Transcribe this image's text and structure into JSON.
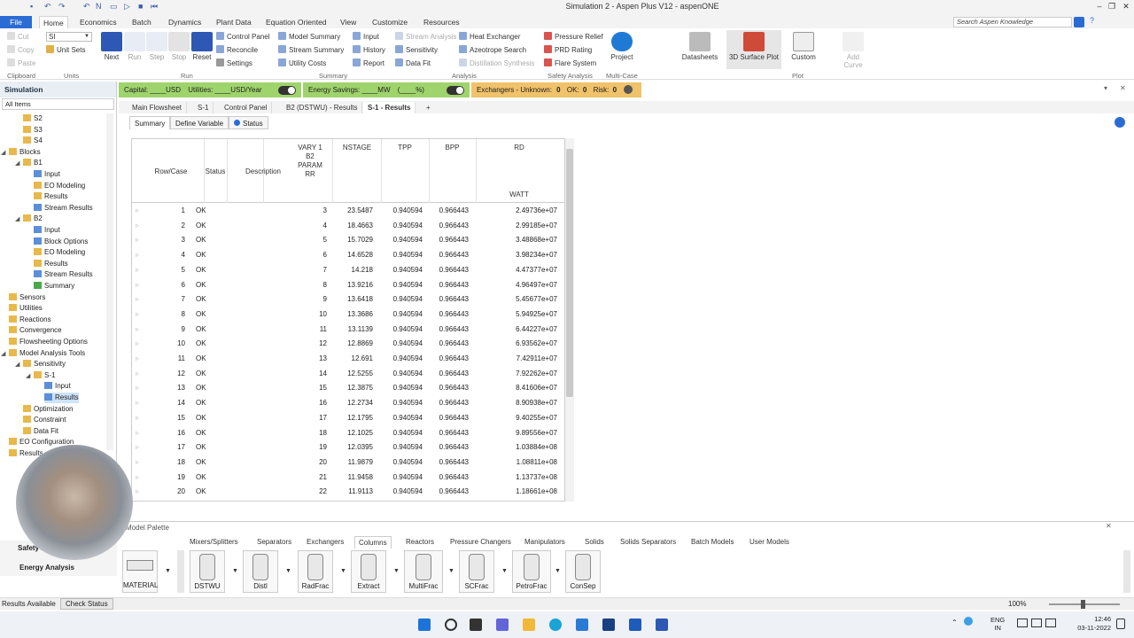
{
  "window": {
    "title": "Simulation 2 - Aspen Plus V12 - aspenONE"
  },
  "ribbon_tabs": [
    "File",
    "Home",
    "Economics",
    "Batch",
    "Dynamics",
    "Plant Data",
    "Equation Oriented",
    "View",
    "Customize",
    "Resources"
  ],
  "search": {
    "placeholder": "Search Aspen Knowledge"
  },
  "ribbon": {
    "clipboard": {
      "cut": "Cut",
      "copy": "Copy",
      "paste": "Paste",
      "group": "Clipboard"
    },
    "units": {
      "value": "SI",
      "unit_sets": "Unit Sets",
      "group": "Units"
    },
    "run": {
      "next": "Next",
      "run": "Run",
      "step": "Step",
      "stop": "Stop",
      "reset": "Reset",
      "control_panel": "Control Panel",
      "reconcile": "Reconcile",
      "settings": "Settings",
      "group": "Run"
    },
    "summary": {
      "model_summary": "Model Summary",
      "stream_summary": "Stream Summary",
      "utility_costs": "Utility Costs",
      "input": "Input",
      "history": "History",
      "report": "Report",
      "group": "Summary"
    },
    "analysis": {
      "stream_analysis": "Stream Analysis",
      "sensitivity": "Sensitivity",
      "data_fit": "Data Fit",
      "heat_exchanger": "Heat Exchanger",
      "azeotrope_search": "Azeotrope Search",
      "distillation_synthesis": "Distillation Synthesis",
      "group": "Analysis"
    },
    "safety": {
      "pressure_relief": "Pressure Relief",
      "prd_rating": "PRD Rating",
      "flare_system": "Flare System",
      "group": "Safety Analysis"
    },
    "multicase": {
      "project": "Project",
      "group": "Multi-Case"
    },
    "plot": {
      "datasheets": "Datasheets",
      "surface": "3D Surface Plot",
      "custom": "Custom",
      "add_curve": "Add Curve",
      "group": "Plot"
    }
  },
  "nav": {
    "header": "Simulation",
    "filter": "All Items",
    "items": [
      "S2",
      "S3",
      "S4",
      "Blocks",
      "B1",
      "Input",
      "EO Modeling",
      "Results",
      "Stream Results",
      "B2",
      "Input",
      "Block Options",
      "EO Modeling",
      "Results",
      "Stream Results",
      "Summary",
      "Sensors",
      "Utilities",
      "Reactions",
      "Convergence",
      "Flowsheeting Options",
      "Model Analysis Tools",
      "Sensitivity",
      "S-1",
      "Input",
      "Results",
      "Optimization",
      "Constraint",
      "Data Fit",
      "EO Configuration",
      "Results"
    ]
  },
  "infobar": {
    "capital": "Capital:  ____USD",
    "utilities": "Utilities:  ____USD/Year",
    "energy": "Energy Savings:  ____MW",
    "energy_pct": "(____%)",
    "exchangers": "Exchangers - Unknown:",
    "unknown": "0",
    "ok_label": "OK:",
    "ok": "0",
    "risk_label": "Risk:",
    "risk": "0"
  },
  "doc_tabs": [
    "Main Flowsheet",
    "S-1",
    "Control Panel",
    "B2 (DSTWU) - Results",
    "S-1 - Results",
    "+"
  ],
  "sub_tabs": [
    "Summary",
    "Define Variable",
    "Status"
  ],
  "grid": {
    "headers": {
      "rowcase": "Row/Case",
      "status": "Status",
      "description": "Description",
      "vary1": "VARY 1",
      "vary2": "B2",
      "vary3": "PARAM",
      "vary4": "RR",
      "nstage": "NSTAGE",
      "tpp": "TPP",
      "bpp": "BPP",
      "rd": "RD",
      "rd_unit": "WATT"
    },
    "rows": [
      [
        "1",
        "OK",
        "3",
        "23.5487",
        "0.940594",
        "0.966443",
        "2.49736e+07"
      ],
      [
        "2",
        "OK",
        "4",
        "18.4663",
        "0.940594",
        "0.966443",
        "2.99185e+07"
      ],
      [
        "3",
        "OK",
        "5",
        "15.7029",
        "0.940594",
        "0.966443",
        "3.48868e+07"
      ],
      [
        "4",
        "OK",
        "6",
        "14.6528",
        "0.940594",
        "0.966443",
        "3.98234e+07"
      ],
      [
        "5",
        "OK",
        "7",
        "14.218",
        "0.940594",
        "0.966443",
        "4.47377e+07"
      ],
      [
        "6",
        "OK",
        "8",
        "13.9216",
        "0.940594",
        "0.966443",
        "4.96497e+07"
      ],
      [
        "7",
        "OK",
        "9",
        "13.6418",
        "0.940594",
        "0.966443",
        "5.45677e+07"
      ],
      [
        "8",
        "OK",
        "10",
        "13.3686",
        "0.940594",
        "0.966443",
        "5.94925e+07"
      ],
      [
        "9",
        "OK",
        "11",
        "13.1139",
        "0.940594",
        "0.966443",
        "6.44227e+07"
      ],
      [
        "10",
        "OK",
        "12",
        "12.8869",
        "0.940594",
        "0.966443",
        "6.93562e+07"
      ],
      [
        "11",
        "OK",
        "13",
        "12.691",
        "0.940594",
        "0.966443",
        "7.42911e+07"
      ],
      [
        "12",
        "OK",
        "14",
        "12.5255",
        "0.940594",
        "0.966443",
        "7.92262e+07"
      ],
      [
        "13",
        "OK",
        "15",
        "12.3875",
        "0.940594",
        "0.966443",
        "8.41606e+07"
      ],
      [
        "14",
        "OK",
        "16",
        "12.2734",
        "0.940594",
        "0.966443",
        "8.90938e+07"
      ],
      [
        "15",
        "OK",
        "17",
        "12.1795",
        "0.940594",
        "0.966443",
        "9.40255e+07"
      ],
      [
        "16",
        "OK",
        "18",
        "12.1025",
        "0.940594",
        "0.966443",
        "9.89556e+07"
      ],
      [
        "17",
        "OK",
        "19",
        "12.0395",
        "0.940594",
        "0.966443",
        "1.03884e+08"
      ],
      [
        "18",
        "OK",
        "20",
        "11.9879",
        "0.940594",
        "0.966443",
        "1.08811e+08"
      ],
      [
        "19",
        "OK",
        "21",
        "11.9458",
        "0.940594",
        "0.966443",
        "1.13737e+08"
      ],
      [
        "20",
        "OK",
        "22",
        "11.9113",
        "0.940594",
        "0.966443",
        "1.18661e+08"
      ]
    ]
  },
  "palette": {
    "title": "Model Palette",
    "tabs": [
      "Mixers/Splitters",
      "Separators",
      "Exchangers",
      "Columns",
      "Reactors",
      "Pressure Changers",
      "Manipulators",
      "Solids",
      "Solids Separators",
      "Batch Models",
      "User Models"
    ],
    "items": [
      "MATERIAL",
      "DSTWU",
      "Distl",
      "RadFrac",
      "Extract",
      "MultiFrac",
      "SCFrac",
      "PetroFrac",
      "ConSep"
    ]
  },
  "left_bottom": {
    "safety": "Safety Analysis",
    "energy": "Energy Analysis"
  },
  "status": {
    "results": "Results Available",
    "check": "Check Status",
    "zoom": "100%"
  },
  "clock": {
    "time": "12:46",
    "date": "03-11-2022",
    "lang": "ENG",
    "region": "IN"
  }
}
